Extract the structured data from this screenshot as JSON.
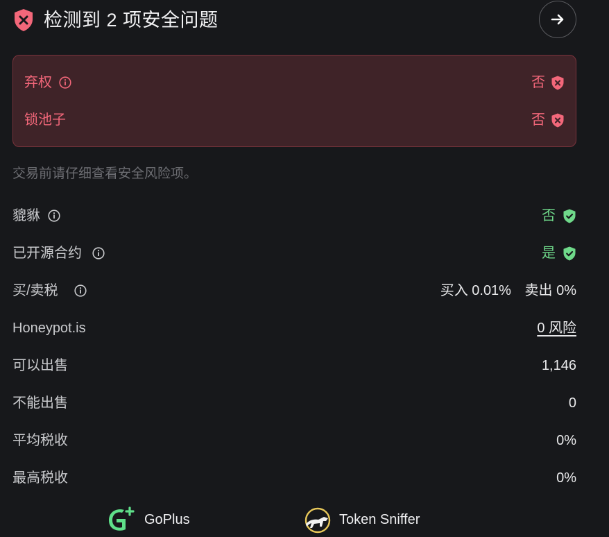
{
  "header": {
    "title": "检测到 2 项安全问题"
  },
  "alerts": [
    {
      "label": "弃权",
      "value": "否",
      "has_info": true
    },
    {
      "label": "锁池子",
      "value": "否",
      "has_info": false
    }
  ],
  "hint": "交易前请仔细查看安全风险项。",
  "checks": {
    "pixiu": {
      "label": "貔貅",
      "value": "否"
    },
    "open_source": {
      "label": "已开源合约",
      "value": "是"
    },
    "tax": {
      "label": "买/卖税",
      "buy": "买入 0.01%",
      "sell": "卖出 0%"
    },
    "honeypot": {
      "label": "Honeypot.is",
      "value": "0 风险"
    },
    "can_sell": {
      "label": "可以出售",
      "value": "1,146"
    },
    "cannot_sell": {
      "label": "不能出售",
      "value": "0"
    },
    "avg_tax": {
      "label": "平均税收",
      "value": "0%"
    },
    "max_tax": {
      "label": "最高税收",
      "value": "0%"
    }
  },
  "providers": {
    "goplus": "GoPlus",
    "token_sniffer": "Token Sniffer"
  },
  "colors": {
    "danger": "#f3677a",
    "danger_bg": "#3f2328",
    "safe": "#6fd98a",
    "background": "#17181b"
  },
  "icons": [
    "shield-x-icon",
    "arrow-right-icon",
    "info-icon",
    "shield-check-icon",
    "goplus-logo-icon",
    "token-sniffer-logo-icon"
  ]
}
